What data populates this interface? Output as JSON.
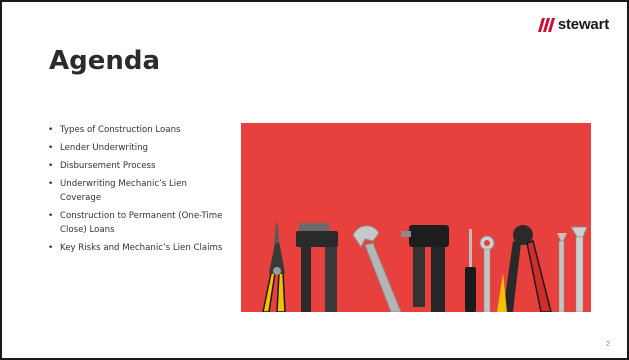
{
  "slide": {
    "brand": "stewart",
    "title": "Agenda",
    "page_number": "2",
    "bullet_glyph": "•",
    "agenda_items": [
      "Types of Construction Loans",
      "Lender Underwriting",
      "Disbursement Process",
      "Underwriting Mechanic’s Lien Coverage",
      "Construction to Permanent (One-Time Close) Loans",
      "Key Risks and Mechanic’s Lien Claims"
    ],
    "image": {
      "icon": "tools-photo-icon",
      "background_color": "#e8403c"
    },
    "colors": {
      "brand_red": "#c8102e",
      "title_text": "#2b2b2b",
      "body_text": "#333333"
    }
  }
}
